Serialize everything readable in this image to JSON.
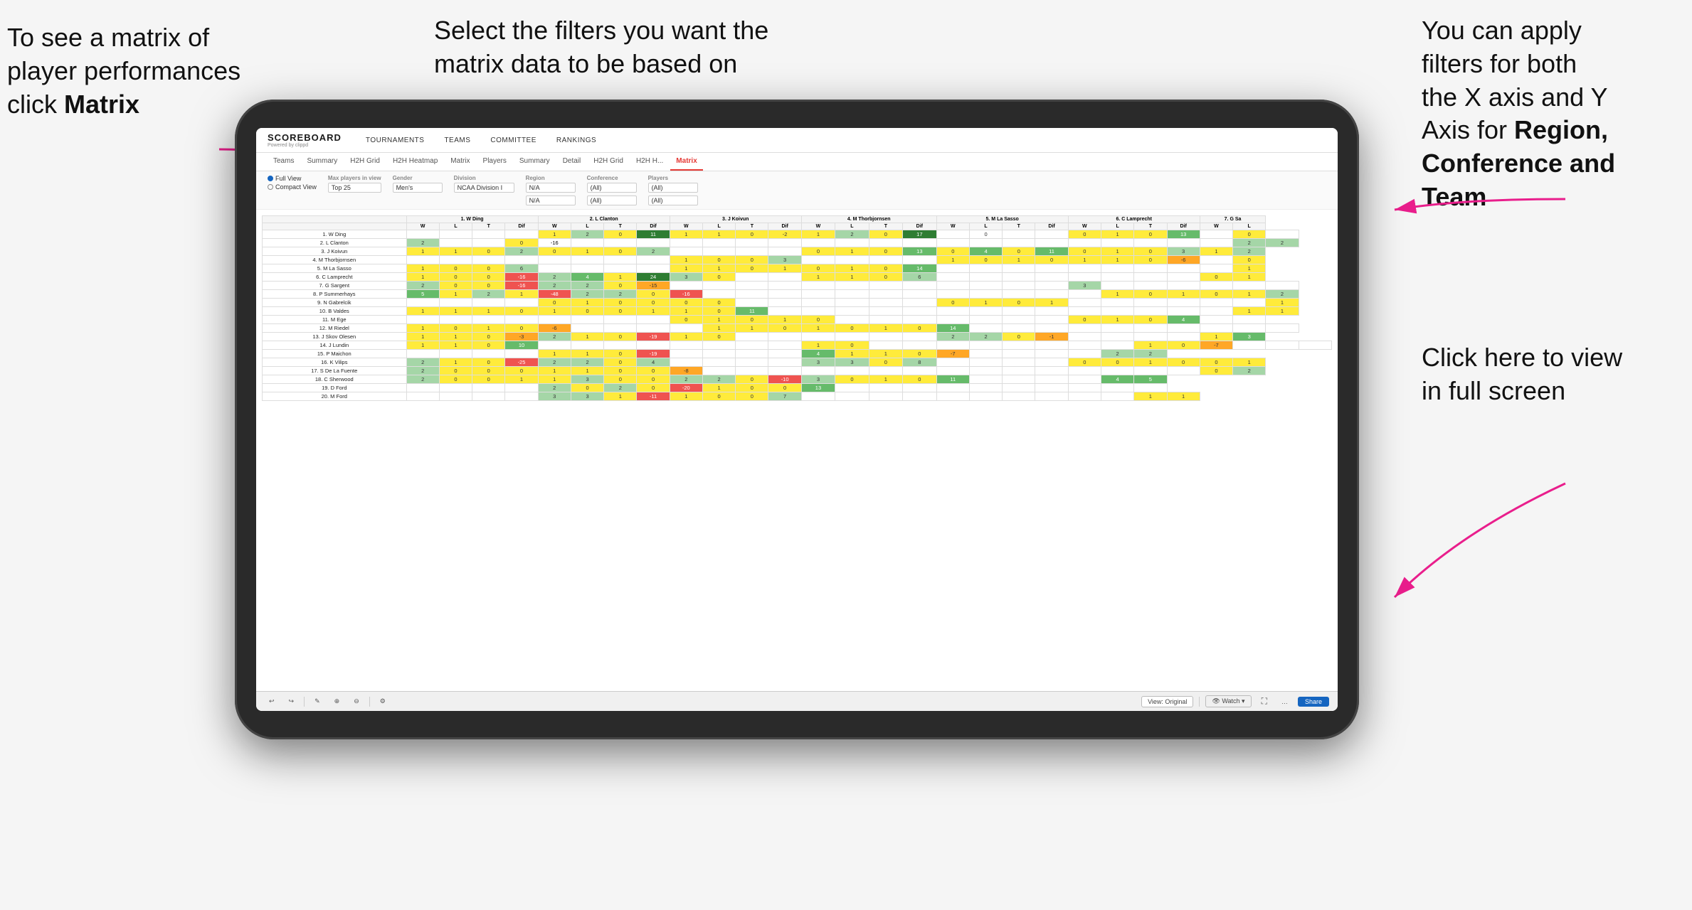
{
  "annotations": {
    "left": {
      "line1": "To see a matrix of",
      "line2": "player performances",
      "line3_prefix": "click ",
      "line3_bold": "Matrix"
    },
    "middle": {
      "line1": "Select the filters you want the",
      "line2": "matrix data to be based on"
    },
    "right_top": {
      "line1": "You  can apply",
      "line2": "filters for both",
      "line3": "the X axis and Y",
      "line4_prefix": "Axis for ",
      "line4_bold": "Region,",
      "line5_bold": "Conference and",
      "line6_bold": "Team"
    },
    "right_bottom": {
      "line1": "Click here to view",
      "line2": "in full screen"
    }
  },
  "nav": {
    "logo": "SCOREBOARD",
    "logo_sub": "Powered by clippd",
    "items": [
      "TOURNAMENTS",
      "TEAMS",
      "COMMITTEE",
      "RANKINGS"
    ]
  },
  "subtabs": {
    "items": [
      "Teams",
      "Summary",
      "H2H Grid",
      "H2H Heatmap",
      "Matrix",
      "Players",
      "Summary",
      "Detail",
      "H2H Grid",
      "H2H H...",
      "Matrix"
    ],
    "active": "Matrix"
  },
  "filters": {
    "view_options": [
      "Full View",
      "Compact View"
    ],
    "max_players_label": "Max players in view",
    "max_players_value": "Top 25",
    "gender_label": "Gender",
    "gender_value": "Men's",
    "division_label": "Division",
    "division_value": "NCAA Division I",
    "region_label": "Region",
    "region_value": "N/A",
    "region_value2": "N/A",
    "conference_label": "Conference",
    "conference_value": "(All)",
    "conference_value2": "(All)",
    "players_label": "Players",
    "players_value": "(All)",
    "players_value2": "(All)"
  },
  "matrix": {
    "col_headers": [
      "1. W Ding",
      "2. L Clanton",
      "3. J Koivun",
      "4. M Thorbjornsen",
      "5. M La Sasso",
      "6. C Lamprecht",
      "7. G Sa"
    ],
    "sub_headers": [
      "W",
      "L",
      "T",
      "Dif"
    ],
    "rows": [
      {
        "label": "1. W Ding",
        "cells": [
          "",
          "",
          "",
          "",
          "1",
          "2",
          "0",
          "11",
          "1",
          "1",
          "0",
          "-2",
          "1",
          "2",
          "0",
          "17",
          "",
          "0",
          "",
          "",
          "0",
          "1",
          "0",
          "13",
          "",
          "0",
          ""
        ]
      },
      {
        "label": "2. L Clanton",
        "cells": [
          "2",
          "",
          "",
          "0",
          "-16",
          "",
          "",
          "",
          "",
          "",
          "",
          "",
          "",
          "",
          "",
          "",
          "",
          "",
          "",
          "",
          "",
          "",
          "",
          "",
          "",
          "2",
          "2"
        ]
      },
      {
        "label": "3. J Koivun",
        "cells": [
          "1",
          "1",
          "0",
          "2",
          "0",
          "1",
          "0",
          "2",
          "",
          "",
          "",
          "",
          "0",
          "1",
          "0",
          "13",
          "0",
          "4",
          "0",
          "11",
          "0",
          "1",
          "0",
          "3",
          "1",
          "2"
        ]
      },
      {
        "label": "4. M Thorbjornsen",
        "cells": [
          "",
          "",
          "",
          "",
          "",
          "",
          "",
          "",
          "1",
          "0",
          "0",
          "3",
          "",
          "",
          "",
          "",
          "1",
          "0",
          "1",
          "0",
          "1",
          "1",
          "0",
          "-6",
          "",
          "0"
        ]
      },
      {
        "label": "5. M La Sasso",
        "cells": [
          "1",
          "0",
          "0",
          "6",
          "",
          "",
          "",
          "",
          "1",
          "1",
          "0",
          "1",
          "0",
          "1",
          "0",
          "14",
          "",
          "",
          "",
          "",
          "",
          "",
          "",
          "",
          "",
          "1"
        ]
      },
      {
        "label": "6. C Lamprecht",
        "cells": [
          "1",
          "0",
          "0",
          "-16",
          "2",
          "4",
          "1",
          "24",
          "3",
          "0",
          "",
          "",
          "1",
          "1",
          "0",
          "6",
          "",
          "",
          "",
          "",
          "",
          "",
          "",
          "",
          "0",
          "1"
        ]
      },
      {
        "label": "7. G Sargent",
        "cells": [
          "2",
          "0",
          "0",
          "-16",
          "2",
          "2",
          "0",
          "-15",
          "",
          "",
          "",
          "",
          "",
          "",
          "",
          "",
          "",
          "",
          "",
          "",
          "3",
          "",
          "",
          "",
          "",
          "",
          ""
        ]
      },
      {
        "label": "8. P Summerhays",
        "cells": [
          "5",
          "1",
          "2",
          "1",
          "-48",
          "2",
          "2",
          "0",
          "-16",
          "",
          "",
          "",
          "",
          "",
          "",
          "",
          "",
          "",
          "",
          "",
          "",
          "1",
          "0",
          "1",
          "0",
          "1",
          "2"
        ]
      },
      {
        "label": "9. N Gabrelcik",
        "cells": [
          "",
          "",
          "",
          "",
          "0",
          "1",
          "0",
          "0",
          "0",
          "0",
          "",
          "",
          "",
          "",
          "",
          "",
          "0",
          "1",
          "0",
          "1",
          "",
          "",
          "",
          "",
          "",
          "",
          "1"
        ]
      },
      {
        "label": "10. B Valdes",
        "cells": [
          "1",
          "1",
          "1",
          "0",
          "1",
          "0",
          "0",
          "1",
          "1",
          "0",
          "11",
          "",
          "",
          "",
          "",
          "",
          "",
          "",
          "",
          "",
          "",
          "",
          "",
          "",
          "",
          "1",
          "1"
        ]
      },
      {
        "label": "11. M Ege",
        "cells": [
          "",
          "",
          "",
          "",
          "",
          "",
          "",
          "",
          "0",
          "1",
          "0",
          "1",
          "0",
          "",
          "",
          "",
          "",
          "",
          "",
          "",
          "0",
          "1",
          "0",
          "4",
          "",
          ""
        ]
      },
      {
        "label": "12. M Riedel",
        "cells": [
          "1",
          "0",
          "1",
          "0",
          "-6",
          "",
          "",
          "",
          "",
          "1",
          "1",
          "0",
          "1",
          "0",
          "1",
          "0",
          "14",
          "",
          "",
          "",
          "",
          "",
          "",
          "",
          "",
          "",
          ""
        ]
      },
      {
        "label": "13. J Skov Olesen",
        "cells": [
          "1",
          "1",
          "0",
          "-3",
          "2",
          "1",
          "0",
          "-19",
          "1",
          "0",
          "",
          "",
          "",
          "",
          "",
          "",
          "2",
          "2",
          "0",
          "-1",
          "",
          "",
          "",
          "",
          "1",
          "3"
        ]
      },
      {
        "label": "14. J Lundin",
        "cells": [
          "1",
          "1",
          "0",
          "10",
          "",
          "",
          "",
          "",
          "",
          "",
          "",
          "",
          "1",
          "0",
          "",
          "",
          "",
          "",
          "",
          "",
          "",
          "",
          "1",
          "0",
          "-7",
          "",
          "",
          ""
        ]
      },
      {
        "label": "15. P Maichon",
        "cells": [
          "",
          "",
          "",
          "",
          "1",
          "1",
          "0",
          "-19",
          "",
          "",
          "",
          "",
          "4",
          "1",
          "1",
          "0",
          "-7",
          "",
          "",
          "",
          "",
          "2",
          "2"
        ]
      },
      {
        "label": "16. K Vilips",
        "cells": [
          "2",
          "1",
          "0",
          "-25",
          "2",
          "2",
          "0",
          "4",
          "",
          "",
          "",
          "",
          "3",
          "3",
          "0",
          "8",
          "",
          "",
          "",
          "",
          "0",
          "0",
          "1",
          "0",
          "0",
          "1"
        ]
      },
      {
        "label": "17. S De La Fuente",
        "cells": [
          "2",
          "0",
          "0",
          "0",
          "1",
          "1",
          "0",
          "0",
          "-8",
          "",
          "",
          "",
          "",
          "",
          "",
          "",
          "",
          "",
          "",
          "",
          "",
          "",
          "",
          "",
          "0",
          "2"
        ]
      },
      {
        "label": "18. C Sherwood",
        "cells": [
          "2",
          "0",
          "0",
          "1",
          "1",
          "3",
          "0",
          "0",
          "2",
          "2",
          "0",
          "-10",
          "3",
          "0",
          "1",
          "0",
          "11",
          "",
          "",
          "",
          "",
          "4",
          "5"
        ]
      },
      {
        "label": "19. D Ford",
        "cells": [
          "",
          "",
          "",
          "",
          "2",
          "0",
          "2",
          "0",
          "-20",
          "1",
          "0",
          "0",
          "13",
          "",
          "",
          "",
          "",
          "",
          "",
          "",
          "",
          "",
          ""
        ]
      },
      {
        "label": "20. M Ford",
        "cells": [
          "",
          "",
          "",
          "",
          "3",
          "3",
          "1",
          "-11",
          "1",
          "0",
          "0",
          "7",
          "",
          "",
          "",
          "",
          "",
          "",
          "",
          "",
          "",
          "",
          "1",
          "1"
        ]
      }
    ]
  },
  "toolbar": {
    "view_original": "View: Original",
    "watch": "Watch",
    "share": "Share"
  },
  "colors": {
    "accent": "#e53935",
    "brand": "#1565c0"
  }
}
